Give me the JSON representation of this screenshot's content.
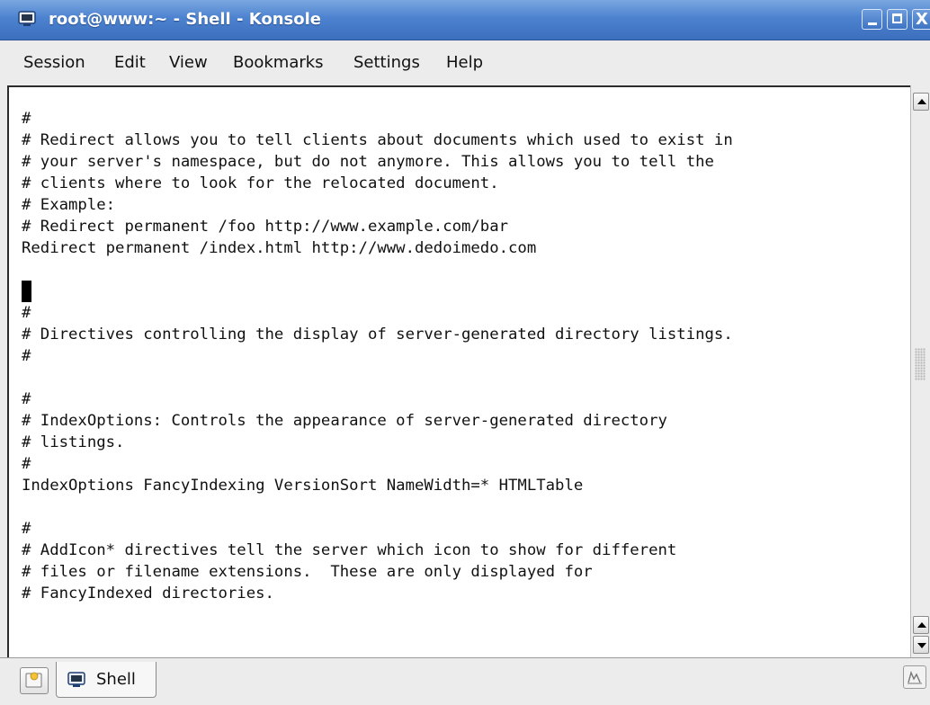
{
  "window": {
    "title": "root@www:~ - Shell - Konsole",
    "title_icon": "terminal-icon",
    "minimize_icon": "minimize-icon",
    "maximize_icon": "maximize-icon",
    "close_icon": "close-icon",
    "close_glyph": "X"
  },
  "menu": {
    "items": [
      "Session",
      "Edit",
      "View",
      "Bookmarks",
      "Settings",
      "Help"
    ]
  },
  "terminal": {
    "lines": [
      "",
      "#",
      "# Redirect allows you to tell clients about documents which used to exist in",
      "# your server's namespace, but do not anymore. This allows you to tell the",
      "# clients where to look for the relocated document.",
      "# Example:",
      "# Redirect permanent /foo http://www.example.com/bar",
      "Redirect permanent /index.html http://www.dedoimedo.com",
      "",
      "#",
      "# Directives controlling the display of server-generated directory listings.",
      "#",
      "",
      "#",
      "# IndexOptions: Controls the appearance of server-generated directory",
      "# listings.",
      "#",
      "IndexOptions FancyIndexing VersionSort NameWidth=* HTMLTable",
      "",
      "#",
      "# AddIcon* directives tell the server which icon to show for different",
      "# files or filename extensions.  These are only displayed for",
      "# FancyIndexed directories."
    ],
    "cursor_line": 9
  },
  "tabs": {
    "new_tab_icon": "new-tab-icon",
    "items": [
      {
        "label": "Shell",
        "icon": "terminal-icon"
      }
    ],
    "corner_icon": "activity-monitor-icon"
  },
  "colors": {
    "titlebar": "#4c82cf",
    "terminal_bg": "#ffffff",
    "terminal_fg": "#111111"
  }
}
